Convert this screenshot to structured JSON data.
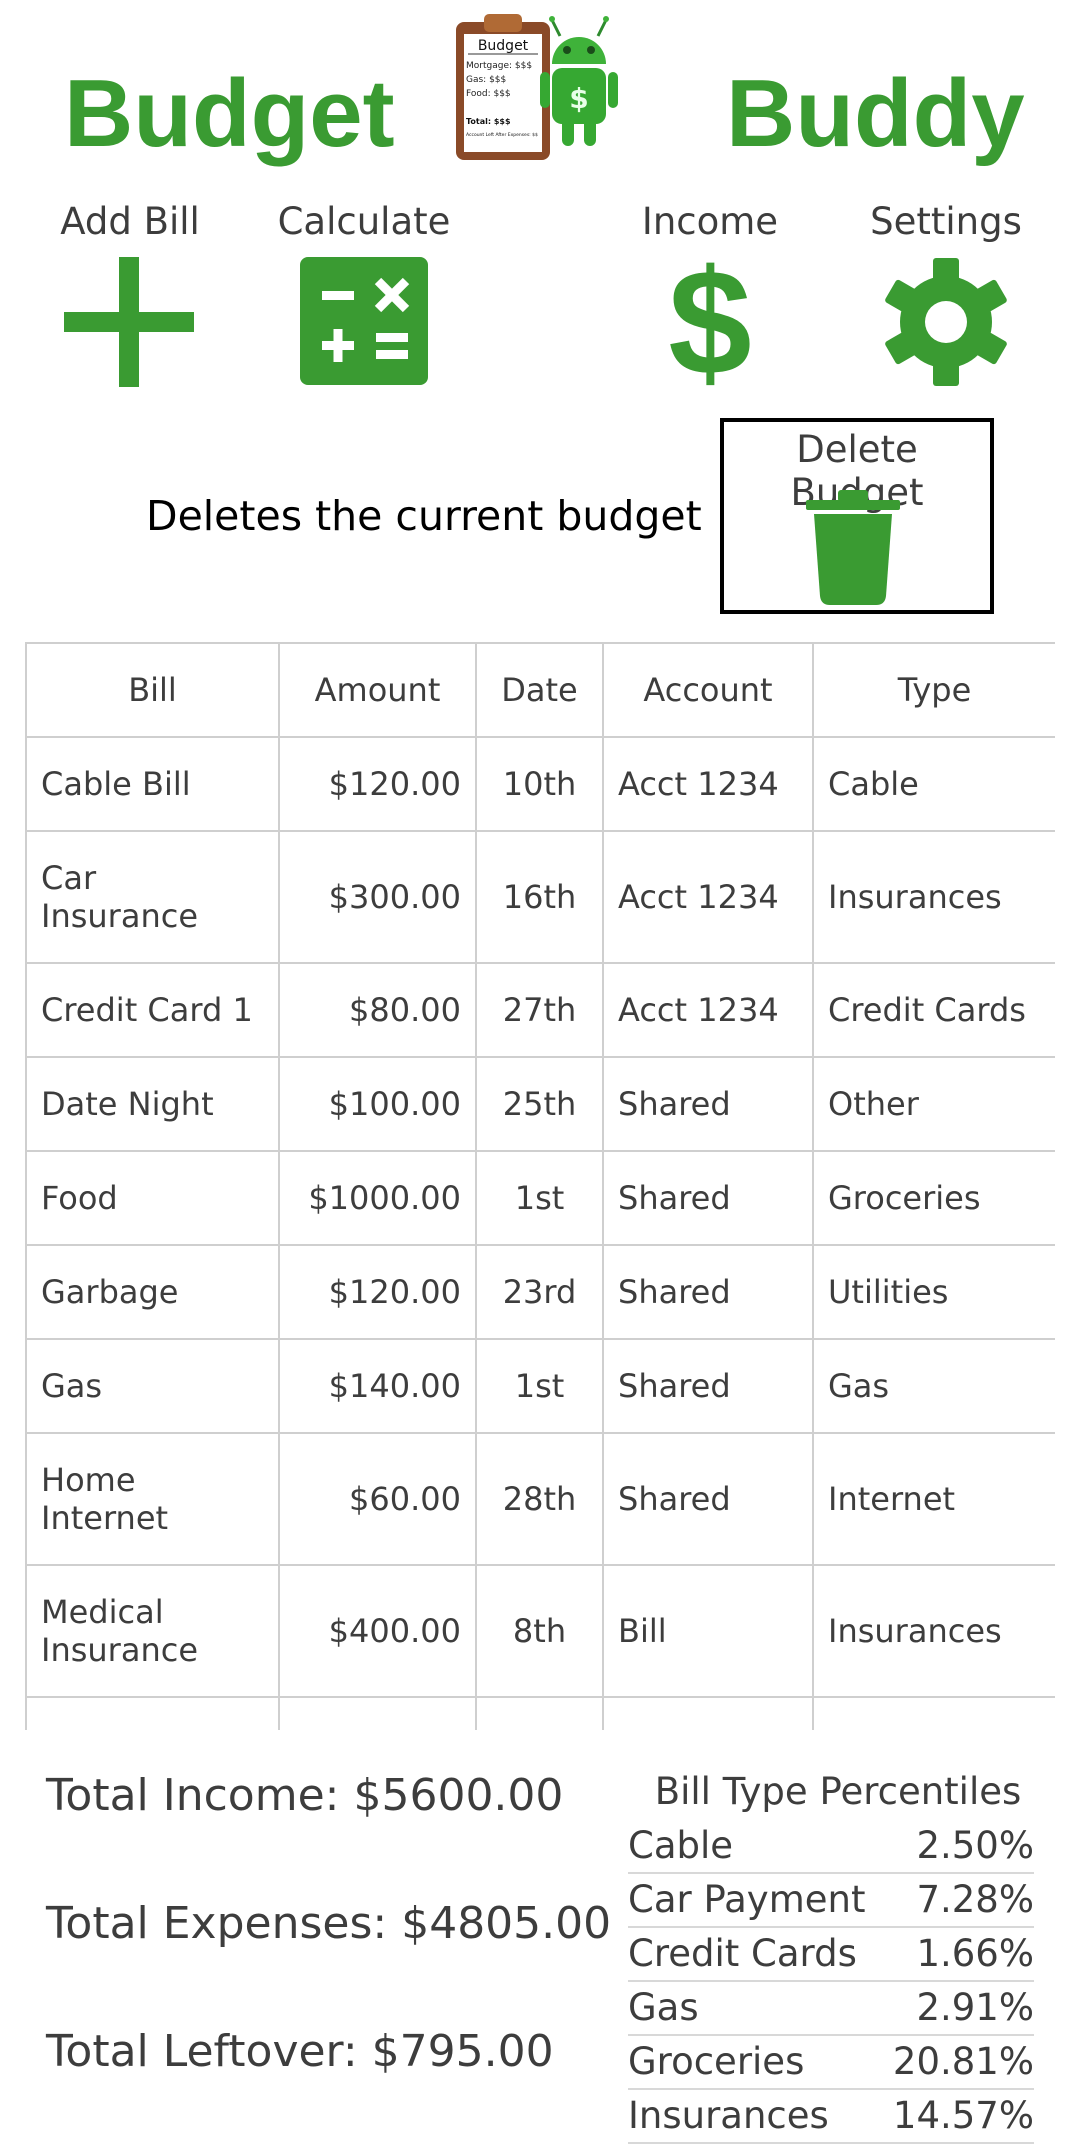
{
  "header": {
    "brand_left": "Budget",
    "brand_right": "Buddy",
    "logo_card": {
      "title": "Budget",
      "lines": [
        "Mortgage: $$$",
        "Gas:           $$$",
        "Food:          $$$"
      ],
      "total": "Total: $$$",
      "footnote": "Account Left After Expenses: $$"
    },
    "logo_coin": "$"
  },
  "toolbar": {
    "add_bill_label": "Add Bill",
    "calculate_label": "Calculate",
    "income_label": "Income",
    "settings_label": "Settings",
    "income_glyph": "$"
  },
  "delete": {
    "label": "Delete Budget",
    "description": "Deletes the current budget"
  },
  "table": {
    "columns": [
      "Bill",
      "Amount",
      "Date",
      "Account",
      "Type"
    ],
    "rows": [
      {
        "bill": "Cable Bill",
        "amount": "$120.00",
        "date": "10th",
        "account": "Acct 1234",
        "type": "Cable"
      },
      {
        "bill": "Car Insurance",
        "amount": "$300.00",
        "date": "16th",
        "account": "Acct 1234",
        "type": "Insurances"
      },
      {
        "bill": "Credit Card 1",
        "amount": "$80.00",
        "date": "27th",
        "account": "Acct 1234",
        "type": "Credit Cards"
      },
      {
        "bill": "Date Night",
        "amount": "$100.00",
        "date": "25th",
        "account": "Shared",
        "type": "Other"
      },
      {
        "bill": "Food",
        "amount": "$1000.00",
        "date": "1st",
        "account": "Shared",
        "type": "Groceries"
      },
      {
        "bill": "Garbage",
        "amount": "$120.00",
        "date": "23rd",
        "account": "Shared",
        "type": "Utilities"
      },
      {
        "bill": "Gas",
        "amount": "$140.00",
        "date": "1st",
        "account": "Shared",
        "type": "Gas"
      },
      {
        "bill": "Home Internet",
        "amount": "$60.00",
        "date": "28th",
        "account": "Shared",
        "type": "Internet"
      },
      {
        "bill": "Medical Insurance",
        "amount": "$400.00",
        "date": "8th",
        "account": "Bill",
        "type": "Insurances"
      },
      {
        "bill": "",
        "amount": "",
        "date": "",
        "account": "",
        "type": ""
      }
    ]
  },
  "totals": {
    "income": "Total Income: $5600.00",
    "expenses": "Total Expenses: $4805.00",
    "leftover": "Total Leftover: $795.00"
  },
  "percentiles": {
    "title": "Bill Type Percentiles",
    "rows": [
      {
        "type": "Cable",
        "pct": "2.50%"
      },
      {
        "type": "Car Payment",
        "pct": "7.28%"
      },
      {
        "type": "Credit Cards",
        "pct": "1.66%"
      },
      {
        "type": "Gas",
        "pct": "2.91%"
      },
      {
        "type": "Groceries",
        "pct": "20.81%"
      },
      {
        "type": "Insurances",
        "pct": "14.57%"
      }
    ]
  },
  "colors": {
    "accent": "#3a9b32",
    "text": "#3d3d3d",
    "grid": "#cfcfcf"
  }
}
